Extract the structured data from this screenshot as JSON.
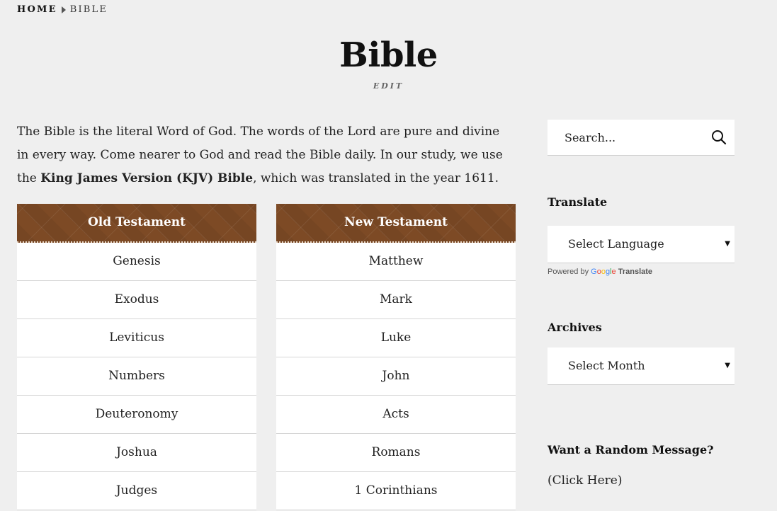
{
  "breadcrumb": {
    "home": "Home",
    "current": "Bible"
  },
  "page": {
    "title": "Bible",
    "edit_label": "EDIT"
  },
  "intro": {
    "part1": "The Bible is the literal Word of God. The words of the Lord are pure and divine in every way. Come nearer to God and read the Bible daily.  In our study, we use the ",
    "bold": "King James Version (KJV) Bible",
    "part2": ", which was translated in the year 1611."
  },
  "old_testament": {
    "header": "Old Testament",
    "books": [
      "Genesis",
      "Exodus",
      "Leviticus",
      "Numbers",
      "Deuteronomy",
      "Joshua",
      "Judges"
    ]
  },
  "new_testament": {
    "header": "New Testament",
    "books": [
      "Matthew",
      "Mark",
      "Luke",
      "John",
      "Acts",
      "Romans",
      "1 Corinthians"
    ]
  },
  "sidebar": {
    "search_placeholder": "Search...",
    "translate_title": "Translate",
    "language_select": "Select Language",
    "powered_by": "Powered by",
    "google_letters": [
      "G",
      "o",
      "o",
      "g",
      "l",
      "e"
    ],
    "translate_word": "Translate",
    "archives_title": "Archives",
    "month_select": "Select Month",
    "random_title": "Want a Random Message?",
    "random_link": "(Click Here)"
  },
  "colors": {
    "header_brown": "#7d4a25",
    "background": "#efefef"
  }
}
